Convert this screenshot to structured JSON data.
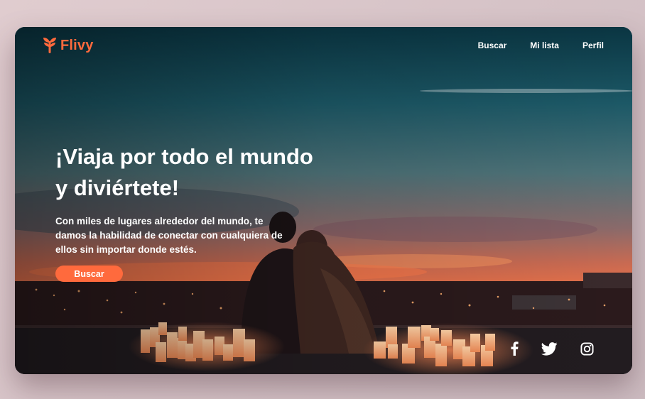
{
  "brand": {
    "name": "Flivy",
    "accent_color": "#ff6a3d",
    "logo_icon": "flivy-logo-icon"
  },
  "nav": {
    "items": [
      {
        "label": "Buscar"
      },
      {
        "label": "Mi lista"
      },
      {
        "label": "Perfil"
      }
    ]
  },
  "hero": {
    "title_lines": [
      "¡Viaja por todo el mundo",
      "y diviértete!"
    ],
    "description_lines": [
      "Con miles de lugares alrededor del mundo, te",
      "damos la habilidad de conectar con cualquiera de",
      "ellos sin importar donde estés."
    ],
    "cta_label": "Buscar",
    "background_image": "couple-sunset-city-candles"
  },
  "social": {
    "icons": [
      "facebook-icon",
      "twitter-icon",
      "instagram-icon"
    ]
  }
}
